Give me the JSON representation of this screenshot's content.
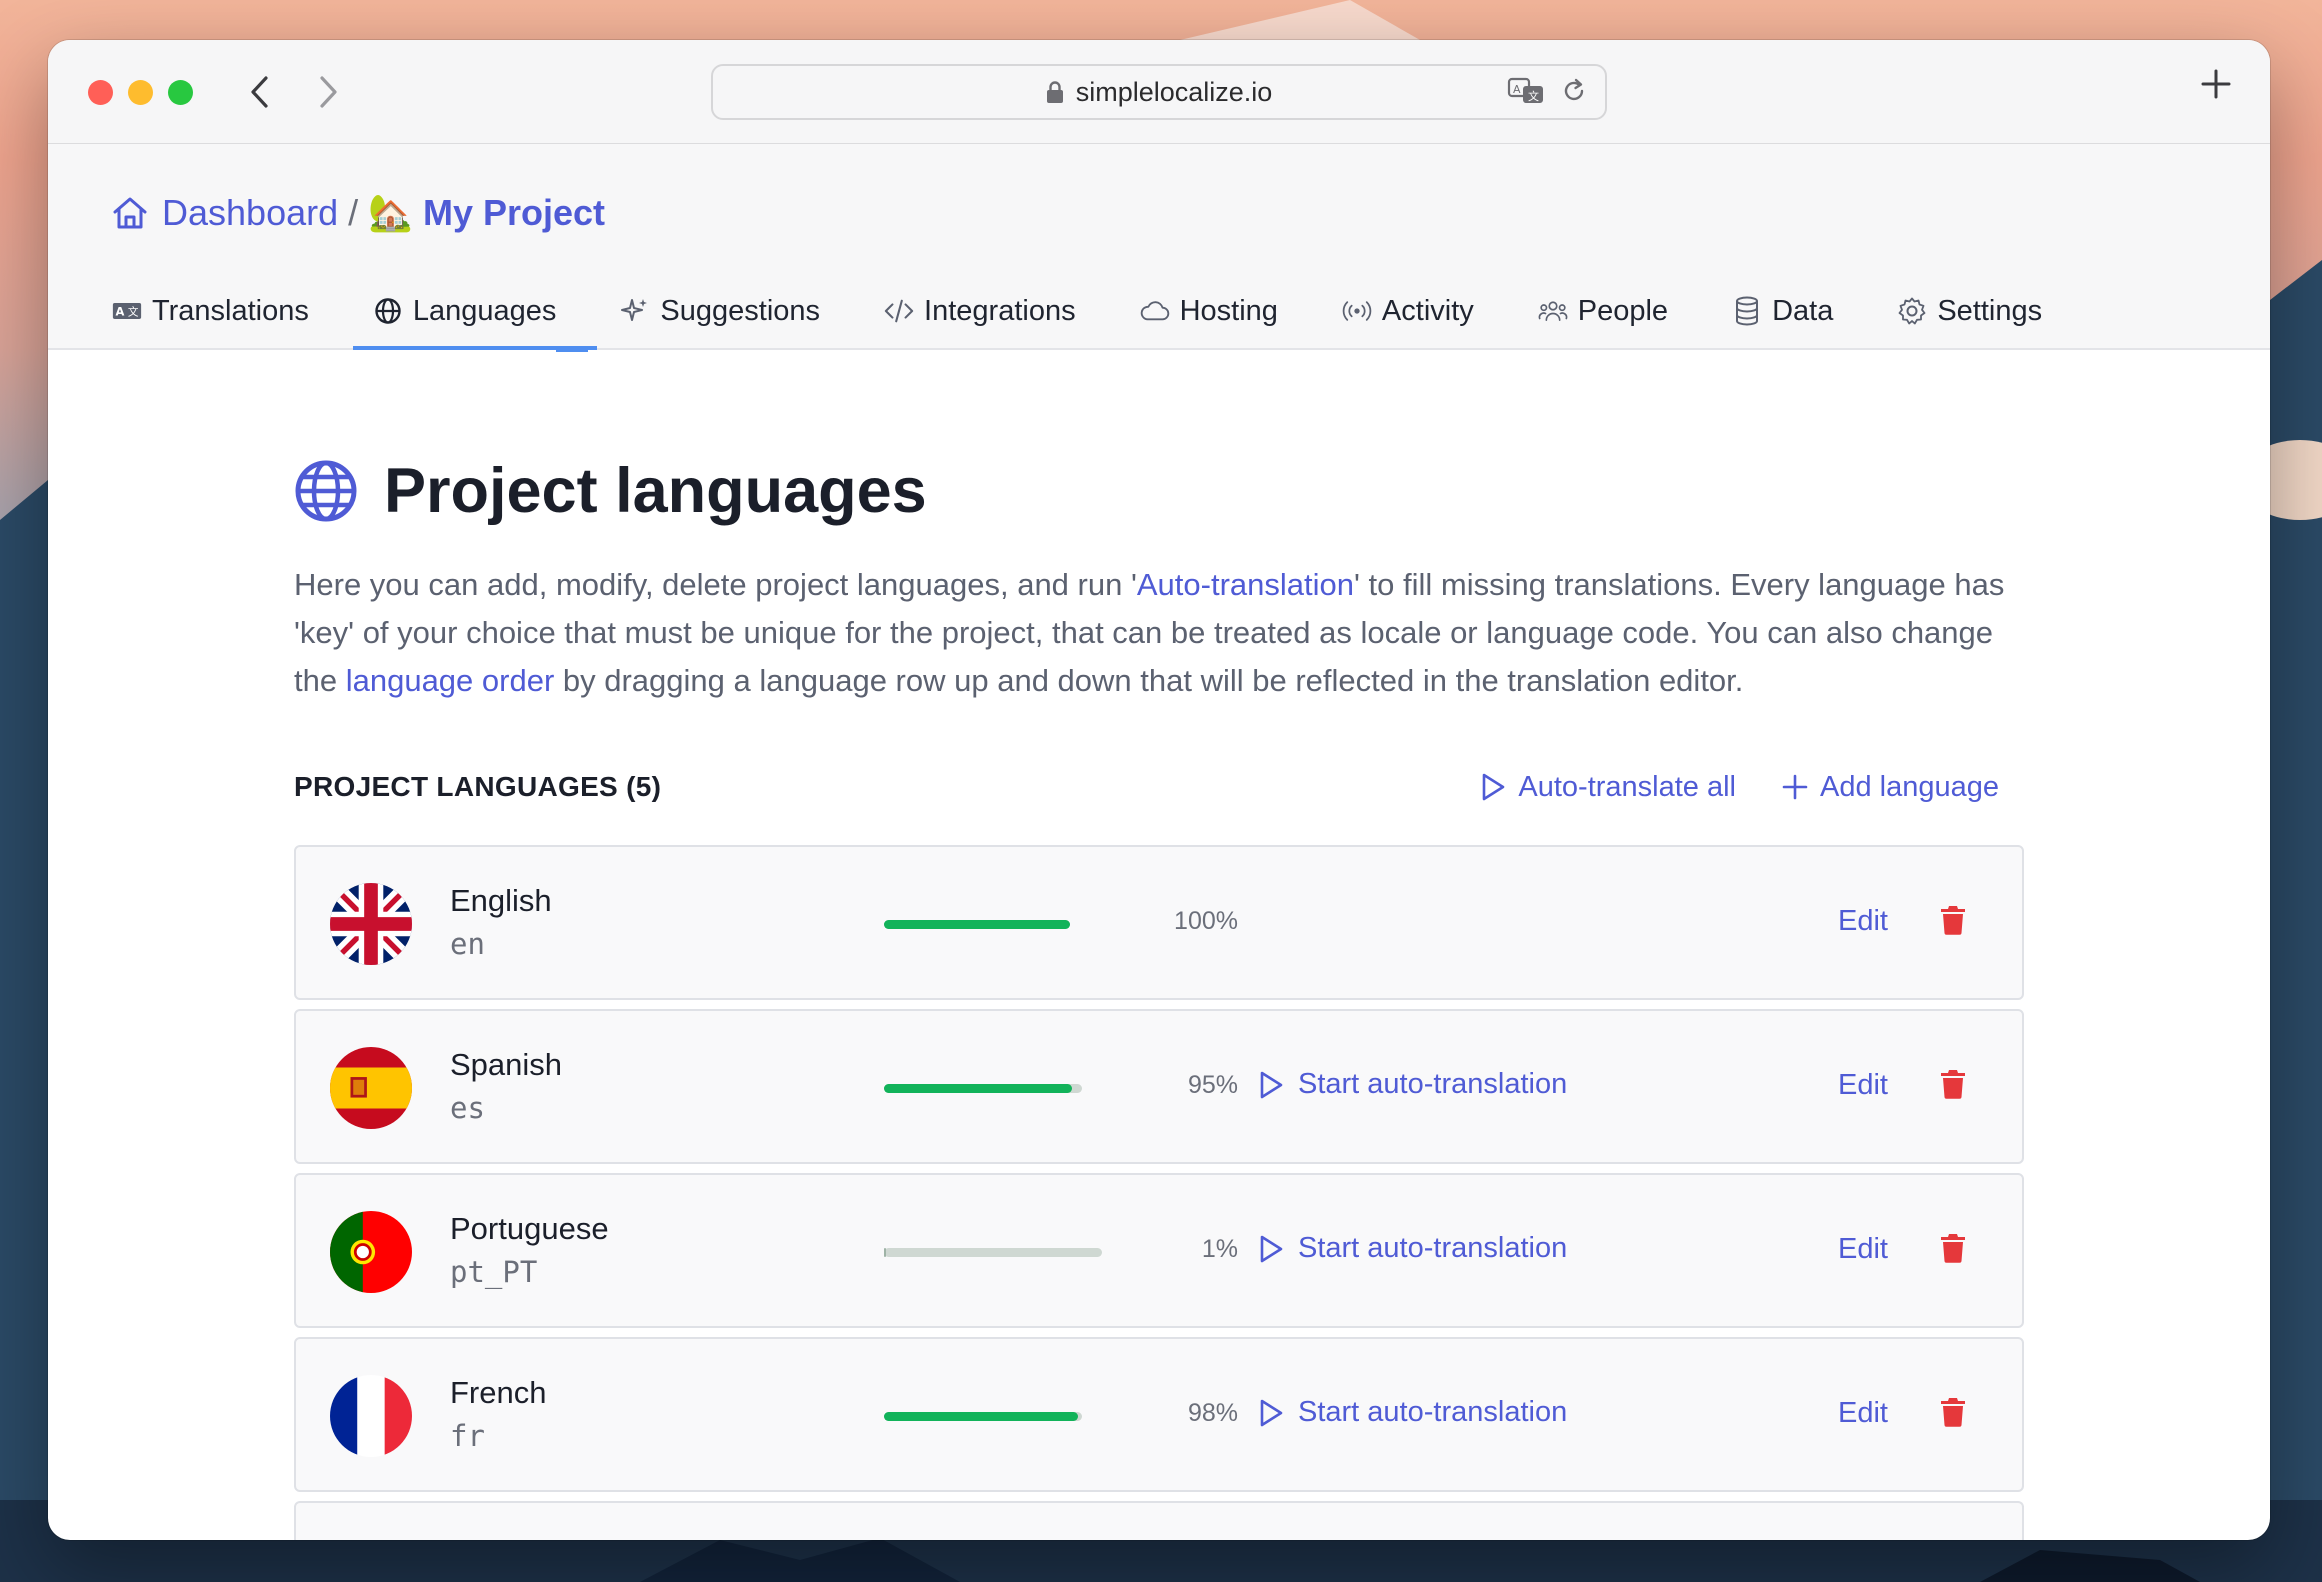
{
  "browser": {
    "url": "simplelocalize.io"
  },
  "breadcrumb": {
    "home": "Dashboard",
    "separator": "/",
    "project_emoji": "🏡",
    "project": "My Project"
  },
  "tabs": [
    {
      "label": "Translations",
      "icon": "translate-icon",
      "active": false
    },
    {
      "label": "Languages",
      "icon": "globe-icon",
      "active": true
    },
    {
      "label": "Suggestions",
      "icon": "sparkle-icon",
      "active": false
    },
    {
      "label": "Integrations",
      "icon": "code-icon",
      "active": false
    },
    {
      "label": "Hosting",
      "icon": "cloud-icon",
      "active": false
    },
    {
      "label": "Activity",
      "icon": "broadcast-icon",
      "active": false
    },
    {
      "label": "People",
      "icon": "people-icon",
      "active": false
    },
    {
      "label": "Data",
      "icon": "database-icon",
      "active": false
    },
    {
      "label": "Settings",
      "icon": "gear-icon",
      "active": false
    }
  ],
  "page": {
    "title": "Project languages",
    "desc_1": "Here you can add, modify, delete project languages, and run '",
    "desc_link_1": "Auto-translation",
    "desc_2": "' to fill missing translations. Every language has 'key' of your choice that must be unique for the project, that can be treated as locale or language code. You can also change the ",
    "desc_link_2": "language order",
    "desc_3": " by dragging a language row up and down that will be reflected in the translation editor."
  },
  "section": {
    "title": "PROJECT LANGUAGES (5)",
    "auto_translate_all": "Auto-translate all",
    "add_language": "Add language"
  },
  "languages": [
    {
      "name": "English",
      "key": "en",
      "percent_label": "100%",
      "progress": 1.0,
      "show_auto": false,
      "flag": "gb"
    },
    {
      "name": "Spanish",
      "key": "es",
      "percent_label": "95%",
      "progress": 0.95,
      "show_auto": true,
      "flag": "es"
    },
    {
      "name": "Portuguese",
      "key": "pt_PT",
      "percent_label": "1%",
      "progress": 0.01,
      "show_auto": true,
      "flag": "pt"
    },
    {
      "name": "French",
      "key": "fr",
      "percent_label": "98%",
      "progress": 0.98,
      "show_auto": true,
      "flag": "fr"
    }
  ],
  "row_actions": {
    "auto_label": "Start auto-translation",
    "edit_label": "Edit"
  },
  "colors": {
    "accent": "#4f5bd5",
    "progress_fill": "#12b35a",
    "progress_track": "#cfd8d2",
    "delete": "#e5383b"
  }
}
